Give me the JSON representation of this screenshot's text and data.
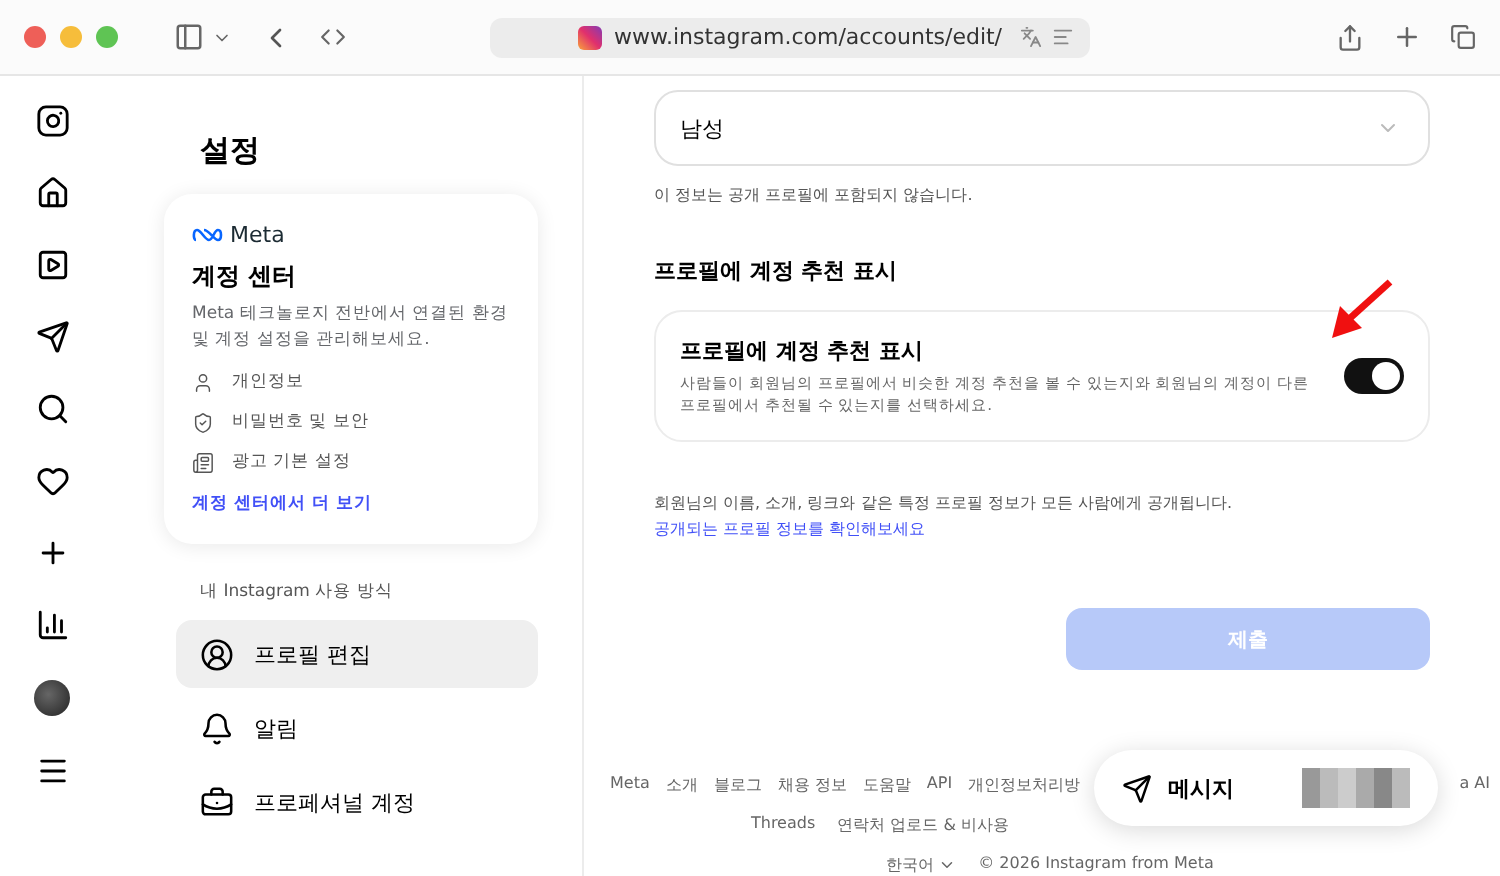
{
  "browser": {
    "url": "www.instagram.com/accounts/edit/"
  },
  "rail": [
    {
      "kind": "logo"
    },
    {
      "kind": "home"
    },
    {
      "kind": "reels"
    },
    {
      "kind": "send"
    },
    {
      "kind": "search"
    },
    {
      "kind": "heart"
    },
    {
      "kind": "plus"
    },
    {
      "kind": "chart"
    },
    {
      "kind": "avatar"
    },
    {
      "kind": "menu"
    }
  ],
  "settings": {
    "title": "설정",
    "accounts_center": {
      "brand": "Meta",
      "title": "계정 센터",
      "description": "Meta 테크놀로지 전반에서 연결된 환경 및 계정 설정을 관리해보세요.",
      "items": [
        {
          "kind": "person",
          "label": "개인정보"
        },
        {
          "kind": "shield",
          "label": "비밀번호 및 보안"
        },
        {
          "kind": "ad",
          "label": "광고 기본 설정"
        }
      ],
      "link": "계정 센터에서 더 보기"
    },
    "section": "내 Instagram 사용 방식",
    "items": [
      {
        "kind": "profile",
        "label": "프로필 편집",
        "selected": true
      },
      {
        "kind": "bell",
        "label": "알림",
        "selected": false
      },
      {
        "kind": "pro",
        "label": "프로페셔널 계정",
        "selected": false
      }
    ]
  },
  "form": {
    "gender": {
      "value": "남성"
    },
    "gender_note": "이 정보는 공개 프로필에 포함되지 않습니다.",
    "suggest_heading": "프로필에 계정 추천 표시",
    "suggest": {
      "title": "프로필에 계정 추천 표시",
      "description": "사람들이 회원님의 프로필에서 비슷한 계정 추천을 볼 수 있는지와 회원님의 계정이 다른 프로필에서 추천될 수 있는지를 선택하세요.",
      "on": true
    },
    "public_note": "회원님의 이름, 소개, 링크와 같은 특정 프로필 정보가 모든 사람에게 공개됩니다.",
    "public_link": "공개되는 프로필 정보를 확인해보세요",
    "submit": "제출"
  },
  "footer": {
    "row1": [
      "Meta",
      "소개",
      "블로그",
      "채용 정보",
      "도움말",
      "API",
      "개인정보처리방"
    ],
    "row1_tail": "a AI",
    "row2": [
      "Threads",
      "연락처 업로드 & 비사용"
    ],
    "language": "한국어",
    "copyright": "© 2026 Instagram from Meta"
  },
  "messages": {
    "label": "메시지"
  }
}
